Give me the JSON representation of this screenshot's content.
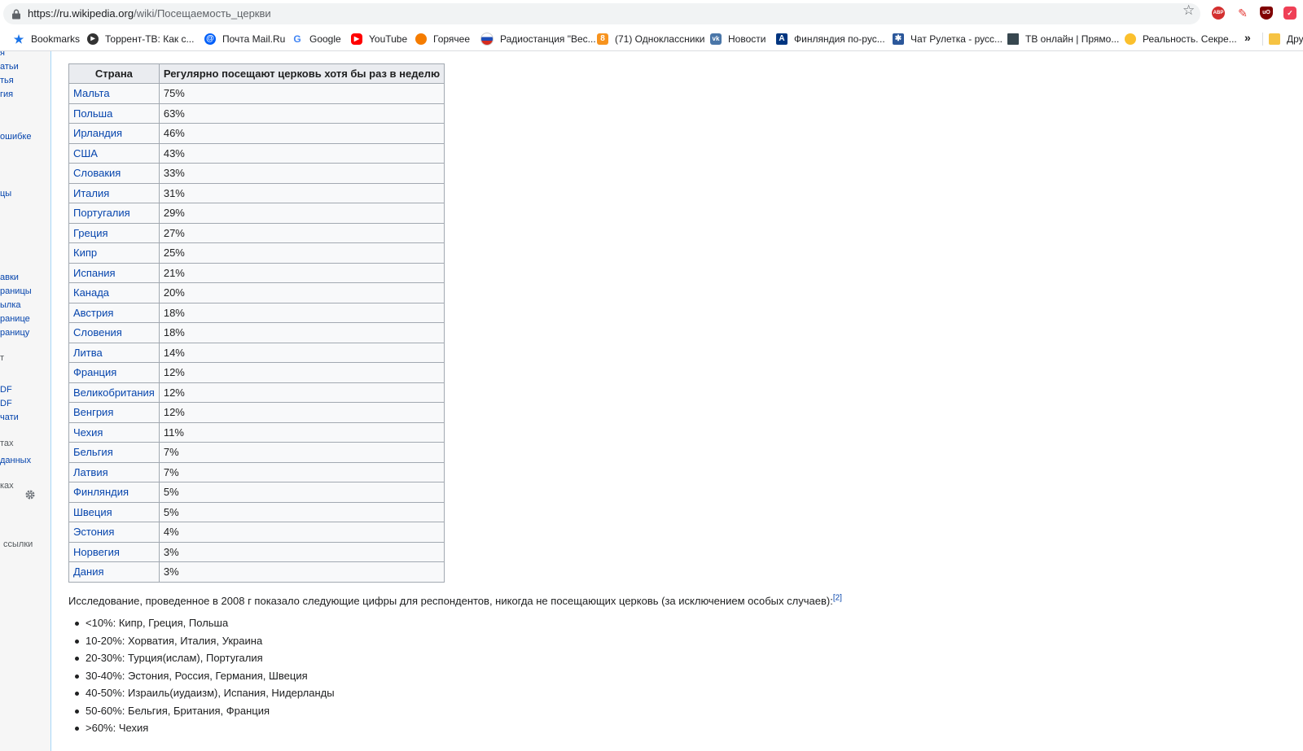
{
  "browser": {
    "url_host": "https://ru.wikipedia.org",
    "url_path": "/wiki/Посещаемость_церкви",
    "bookmarks": [
      {
        "label": "Bookmarks",
        "icon": "star-icon",
        "color": "#1a73e8"
      },
      {
        "label": "Торрент-ТВ: Как с...",
        "icon": "torrent-tv-icon",
        "color": "#333333"
      },
      {
        "label": "Почта Mail.Ru",
        "icon": "mailru-icon",
        "color": "#005ff9"
      },
      {
        "label": "Google",
        "icon": "google-icon",
        "color": "#4285f4"
      },
      {
        "label": "YouTube",
        "icon": "youtube-icon",
        "color": "#ff0000"
      },
      {
        "label": "Горячее",
        "icon": "pikabu-icon",
        "color": "#f57c00"
      },
      {
        "label": "Радиостанция \"Вес...",
        "icon": "radio-vesti-icon",
        "color": "#1e4db7"
      },
      {
        "label": "(71) Одноклассники",
        "icon": "odnoklassniki-icon",
        "color": "#f7931e"
      },
      {
        "label": "Новости",
        "icon": "vk-icon",
        "color": "#4a76a8"
      },
      {
        "label": "Финляндия по-рус...",
        "icon": "finland-icon",
        "color": "#003580"
      },
      {
        "label": "Чат Рулетка - русс...",
        "icon": "chat-roulette-icon",
        "color": "#2b579a"
      },
      {
        "label": "ТВ онлайн | Прямо...",
        "icon": "tv-online-icon",
        "color": "#37474f"
      },
      {
        "label": "Реальность. Секре...",
        "icon": "reality-icon",
        "color": "#fbc02d"
      },
      {
        "label": "Друг",
        "icon": "folder-icon",
        "color": "#f6c343"
      }
    ],
    "overflow_label": "»",
    "extensions": {
      "abp": "ABP",
      "ublock": "uO"
    }
  },
  "sidebar": {
    "items": [
      "я",
      "атьи",
      "тья",
      "гия",
      "ошибке",
      "",
      "цы",
      "авки",
      "раницы",
      "ылка",
      "ранице",
      "раницу",
      "т",
      "DF",
      "DF",
      "чати",
      "тах",
      "данных",
      "ках",
      "ссылки"
    ]
  },
  "table": {
    "headers": [
      "Страна",
      "Регулярно посещают церковь хотя бы раз в неделю"
    ],
    "rows": [
      [
        "Мальта",
        "75%"
      ],
      [
        "Польша",
        "63%"
      ],
      [
        "Ирландия",
        "46%"
      ],
      [
        "США",
        "43%"
      ],
      [
        "Словакия",
        "33%"
      ],
      [
        "Италия",
        "31%"
      ],
      [
        "Португалия",
        "29%"
      ],
      [
        "Греция",
        "27%"
      ],
      [
        "Кипр",
        "25%"
      ],
      [
        "Испания",
        "21%"
      ],
      [
        "Канада",
        "20%"
      ],
      [
        "Австрия",
        "18%"
      ],
      [
        "Словения",
        "18%"
      ],
      [
        "Литва",
        "14%"
      ],
      [
        "Франция",
        "12%"
      ],
      [
        "Великобритания",
        "12%"
      ],
      [
        "Венгрия",
        "12%"
      ],
      [
        "Чехия",
        "11%"
      ],
      [
        "Бельгия",
        "7%"
      ],
      [
        "Латвия",
        "7%"
      ],
      [
        "Финляндия",
        "5%"
      ],
      [
        "Швеция",
        "5%"
      ],
      [
        "Эстония",
        "4%"
      ],
      [
        "Норвегия",
        "3%"
      ],
      [
        "Дания",
        "3%"
      ]
    ]
  },
  "paragraph": {
    "text": "Исследование, проведенное в 2008 г показало следующие цифры для респондентов, никогда не посещающих церковь (за исключением особых случаев):",
    "ref": "[2]"
  },
  "bullets": [
    "<10%: Кипр, Греция, Польша",
    "10-20%: Хорватия, Италия, Украина",
    "20-30%: Турция(ислам), Португалия",
    "30-40%: Эстония, Россия, Германия, Швеция",
    "40-50%: Израиль(иудаизм), Испания, Нидерланды",
    "50-60%: Бельгия, Британия, Франция",
    ">60%: Чехия"
  ],
  "colors": {
    "link": "#0645ad",
    "text": "#202122",
    "table_border": "#a2a9b1",
    "header_bg": "#eaecf0"
  }
}
